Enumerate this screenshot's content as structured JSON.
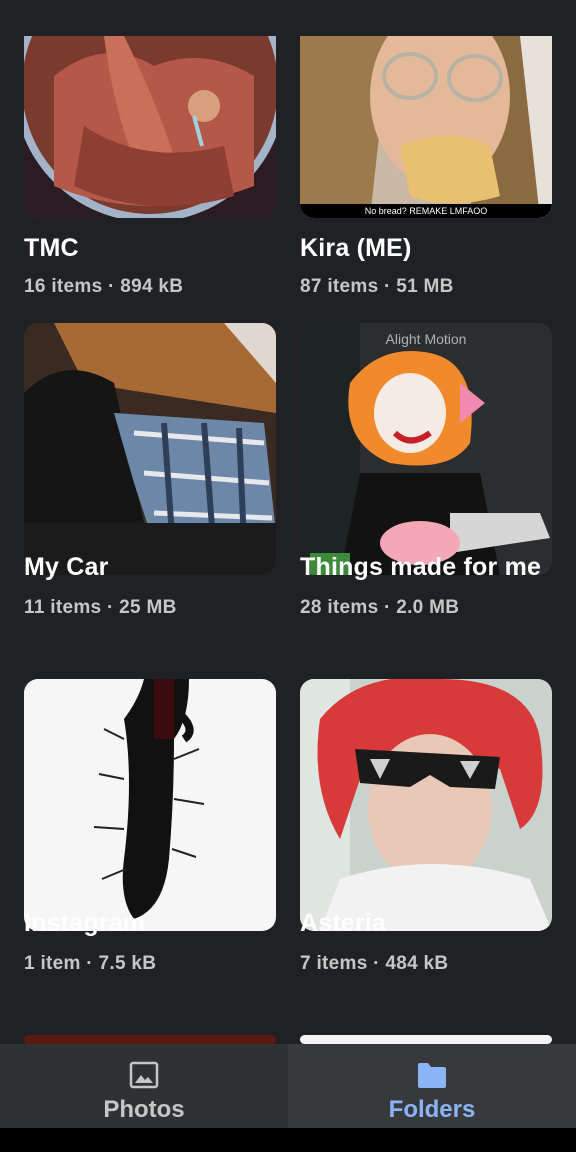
{
  "folders": [
    {
      "name": "TMC",
      "meta": "16 items · 894 kB",
      "thumb_caption": ""
    },
    {
      "name": "Kira (ME)",
      "meta": "87 items · 51 MB",
      "thumb_caption": "No bread? REMAKE LMFAOO"
    },
    {
      "name": "My Car",
      "meta": "11 items · 25 MB"
    },
    {
      "name": "Things made for me",
      "meta": "28 items · 2.0 MB",
      "thumb_watermark": "Alight Motion"
    },
    {
      "name": "Instagram",
      "meta": "1 item · 7.5 kB"
    },
    {
      "name": "Asteria",
      "meta": "7 items · 484 kB"
    }
  ],
  "bottom_nav": {
    "photos_label": "Photos",
    "folders_label": "Folders",
    "active": "Folders",
    "photos_icon": "image-icon",
    "folders_icon": "folder-icon"
  },
  "colors": {
    "background": "#202124",
    "nav_background": "#303134",
    "accent": "#8ab4f8",
    "text_primary": "#ffffff",
    "text_secondary": "#c4c7c5"
  }
}
